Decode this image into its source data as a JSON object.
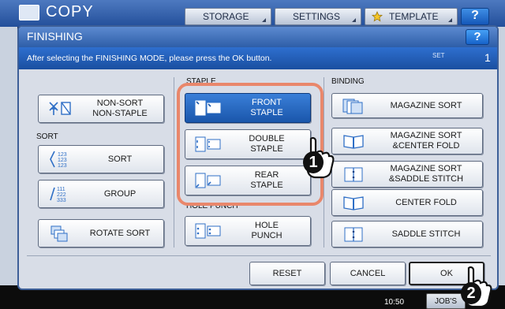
{
  "background": {
    "title": "COPY",
    "tabs": [
      "STORAGE",
      "SETTINGS",
      "TEMPLATE"
    ],
    "help_label": "?",
    "time": "10:50",
    "jobs_label": "JOB'S"
  },
  "dialog": {
    "title": "FINISHING",
    "help_label": "?",
    "message": "After selecting the FINISHING MODE, please press the OK button.",
    "set_label": "SET",
    "set_number": "1"
  },
  "sections": {
    "sort": "SORT",
    "staple": "STAPLE",
    "hole_punch": "HOLE PUNCH",
    "binding": "BINDING"
  },
  "buttons": {
    "non_sort": "NON-SORT\nNON-STAPLE",
    "sort": "SORT",
    "group": "GROUP",
    "rotate_sort": "ROTATE SORT",
    "front_staple": "FRONT\nSTAPLE",
    "double_staple": "DOUBLE\nSTAPLE",
    "rear_staple": "REAR\nSTAPLE",
    "hole_punch": "HOLE\nPUNCH",
    "magazine_sort": "MAGAZINE SORT",
    "magazine_sort_center_fold": "MAGAZINE SORT\n&CENTER FOLD",
    "magazine_sort_saddle_stitch": "MAGAZINE SORT\n&SADDLE STITCH",
    "center_fold": "CENTER FOLD",
    "saddle_stitch": "SADDLE STITCH",
    "reset": "RESET",
    "cancel": "CANCEL",
    "ok": "OK"
  },
  "callouts": {
    "step1": "1",
    "step2": "2"
  },
  "colors": {
    "accent": "#1a56ab",
    "highlight": "#e9876b"
  }
}
